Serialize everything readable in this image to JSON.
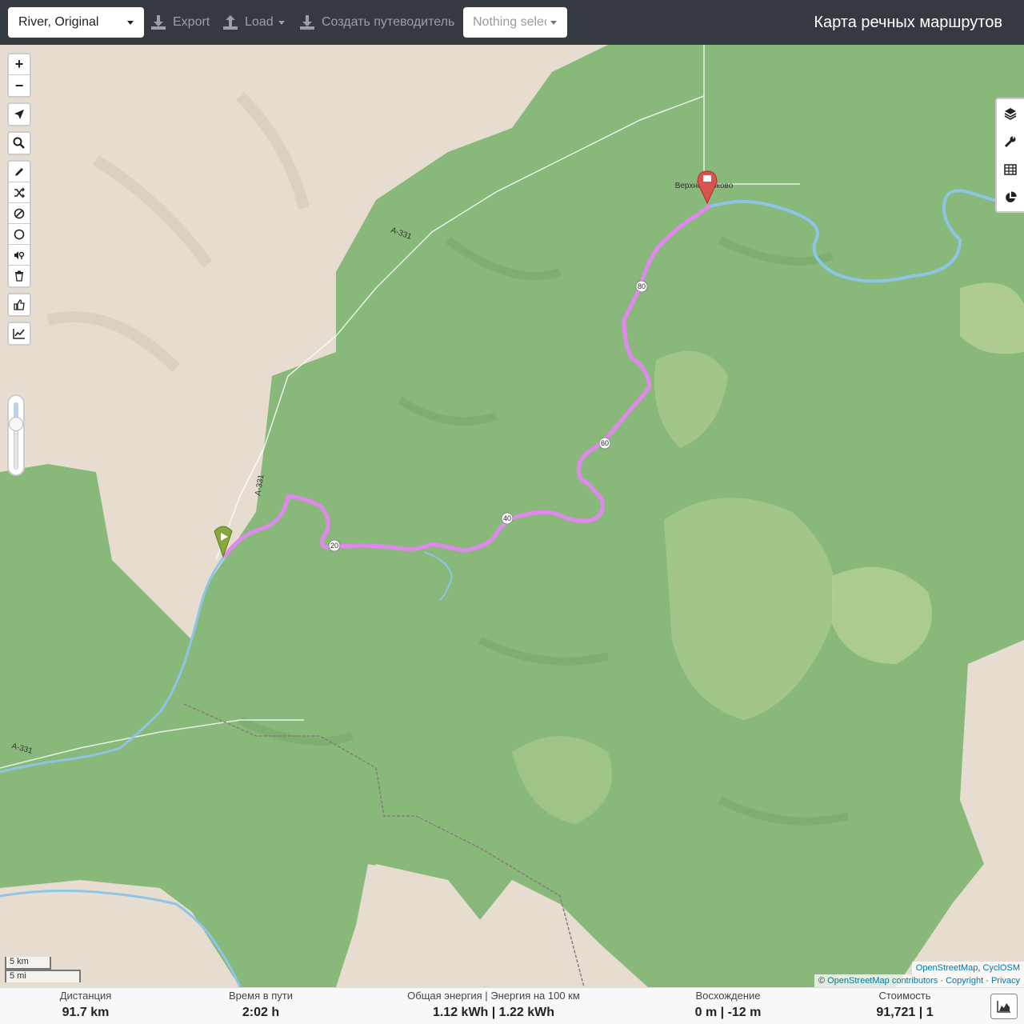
{
  "topbar": {
    "profile_select": "River, Original",
    "export_label": "Export",
    "load_label": "Load",
    "guide_label": "Создать путеводитель",
    "nothing_selected": "Nothing selected",
    "brand": "Карта речных маршрутов"
  },
  "map": {
    "zoom_in": "+",
    "zoom_out": "−",
    "town_label": "Верхнемарково",
    "road_label_1": "A-331",
    "road_label_2": "A-331",
    "road_label_3": "A-331",
    "km_markers": [
      "20",
      "40",
      "60",
      "80"
    ],
    "scale_km": "5 km",
    "scale_mi": "5 mi",
    "attribution_1": {
      "osm": "OpenStreetMap",
      "sep": ", ",
      "cyclosm": "CyclOSM"
    },
    "attribution_2": {
      "prefix": "© ",
      "contributors": "OpenStreetMap contributors",
      "sep1": " · ",
      "copyright": "Copyright",
      "sep2": " · ",
      "privacy": "Privacy"
    },
    "colors": {
      "forest": "#88b87a",
      "land": "#e6ddd0",
      "river": "#8ec5e6",
      "route": "#e088ee",
      "start_marker": "#86a83a",
      "end_marker": "#d9534f"
    }
  },
  "stats": {
    "distance_label": "Дистанция",
    "distance_value": "91.7 km",
    "time_label": "Время в пути",
    "time_value": "2:02 h",
    "energy_label": "Общая энергия | Энергия на 100 км",
    "energy_value": "1.12 kWh | 1.22 kWh",
    "ascent_label": "Восхождение",
    "ascent_value": "0 m | -12 m",
    "cost_label": "Стоимость",
    "cost_value": "91,721 | 1"
  }
}
